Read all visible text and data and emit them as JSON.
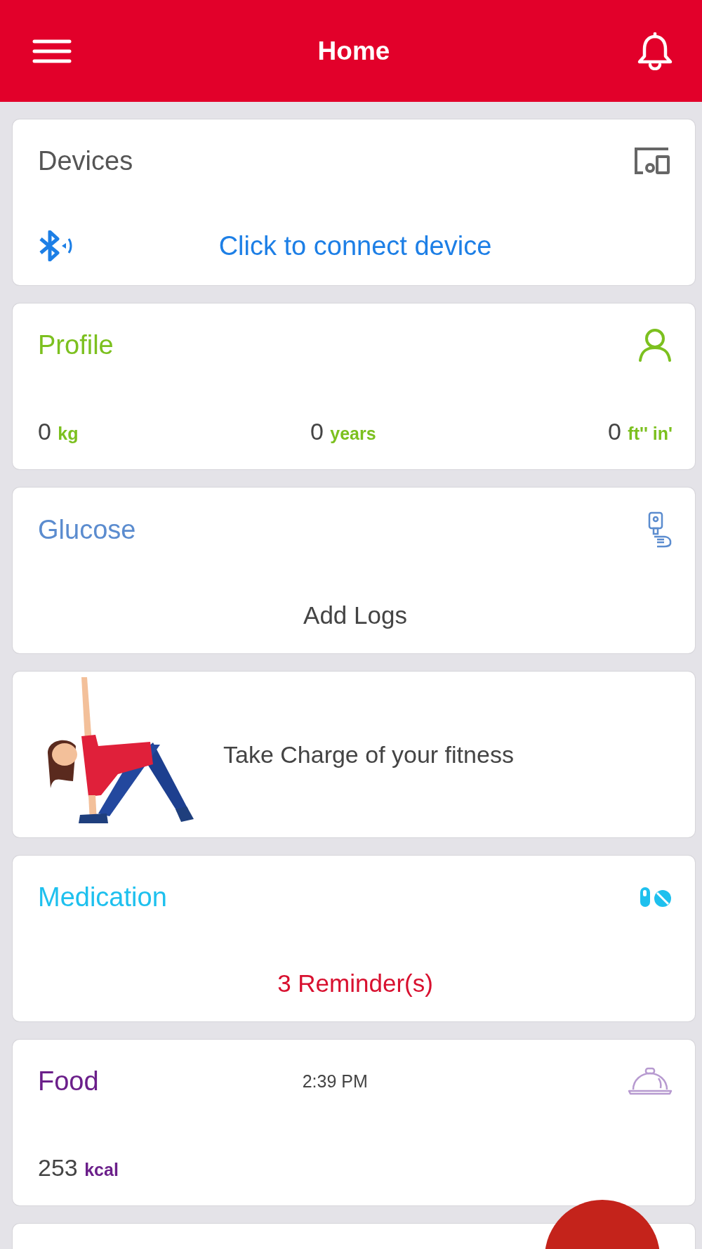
{
  "header": {
    "title": "Home"
  },
  "cards": [
    {
      "kind": "devices",
      "title": "Devices",
      "color": "#555555",
      "link": "Click to connect device"
    },
    {
      "kind": "profile",
      "title": "Profile",
      "color": "#7cc01f",
      "stats": [
        {
          "value": "0",
          "unit": "kg"
        },
        {
          "value": "0",
          "unit": "years"
        },
        {
          "value": "0",
          "unit": "ft'' in'"
        }
      ]
    },
    {
      "kind": "glucose",
      "title": "Glucose",
      "color": "#5b8ccf",
      "action": "Add Logs"
    },
    {
      "kind": "fitness",
      "text": "Take Charge of your fitness"
    },
    {
      "kind": "medication",
      "title": "Medication",
      "color": "#1ec0ee",
      "reminders": "3 Reminder(s)"
    },
    {
      "kind": "food",
      "title": "Food",
      "color": "#6b1f8a",
      "time": "2:39 PM",
      "stats": [
        {
          "value": "253",
          "unit": "kcal"
        }
      ]
    },
    {
      "kind": "blank"
    }
  ]
}
